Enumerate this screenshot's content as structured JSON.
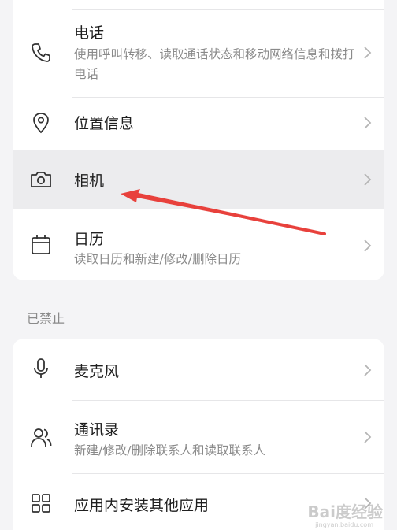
{
  "permissions_allowed": {
    "items": [
      {
        "title": "电话",
        "subtitle": "使用呼叫转移、读取通话状态和移动网络信息和拨打电话",
        "icon": "phone-icon"
      },
      {
        "title": "位置信息",
        "icon": "location-pin-icon"
      },
      {
        "title": "相机",
        "icon": "camera-icon"
      },
      {
        "title": "日历",
        "subtitle": "读取日历和新建/修改/删除日历",
        "icon": "calendar-icon"
      }
    ]
  },
  "permissions_denied": {
    "section_label": "已禁止",
    "items": [
      {
        "title": "麦克风",
        "icon": "microphone-icon"
      },
      {
        "title": "通讯录",
        "subtitle": "新建/修改/删除联系人和读取联系人",
        "icon": "contacts-icon"
      },
      {
        "title": "应用内安装其他应用",
        "icon": "apps-grid-icon"
      }
    ]
  },
  "watermark": {
    "text": "Bai度经验",
    "sub": "jingyan.baidu.com"
  },
  "colors": {
    "annotation_arrow": "#e8413c",
    "highlight_row": "#ececee"
  }
}
